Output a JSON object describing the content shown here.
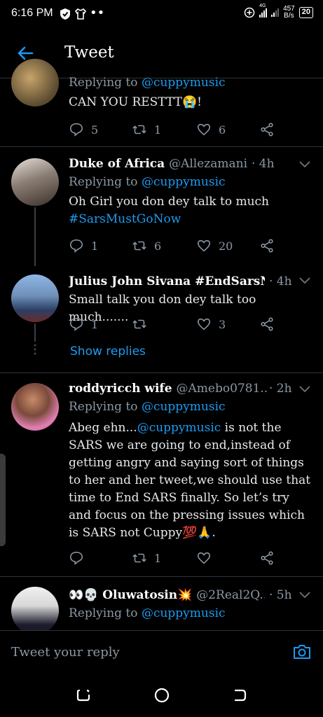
{
  "status_bar": {
    "time": "6:16 PM",
    "net_speed_value": "457",
    "net_speed_unit": "B/s",
    "battery": "20",
    "signal_label": "4G"
  },
  "header": {
    "title": "Tweet"
  },
  "tweets": [
    {
      "reply_prefix": "Replying to ",
      "reply_to": "@cuppymusic",
      "text": "CAN YOU RESTTT😭!",
      "replies": "5",
      "retweets": "1",
      "likes": "6"
    },
    {
      "name": "Duke of Africa",
      "handle": "@Allezamani",
      "time": "· 4h",
      "reply_prefix": "Replying to ",
      "reply_to": "@cuppymusic",
      "text_line1": "Oh Girl you don dey talk to much",
      "hashtag": "#SarsMustGoNow",
      "replies": "1",
      "retweets": "6",
      "likes": "20"
    },
    {
      "name": "Julius John Sivana #EndSarsN...",
      "time": "· 4h",
      "text": "Small talk you don dey talk too much.......",
      "replies": "1",
      "retweets": "",
      "likes": "3",
      "show_replies": "Show replies"
    },
    {
      "name": "roddyricch wife",
      "handle": "@Amebo0781...",
      "time": "· 2h",
      "reply_prefix": "Replying to ",
      "reply_to": "@cuppymusic",
      "text_prefix": "Abeg ehn...",
      "text_mention": "@cuppymusic",
      "text_rest": " is not the SARS we are going to end,instead of getting angry and saying sort of things to her and her tweet,we should use that time to End SARS finally. So let’s try and focus on the pressing issues which is SARS not Cuppy💯🙏.",
      "replies": "",
      "retweets": "1",
      "likes": ""
    },
    {
      "name": "👀💀 Oluwatosin💥",
      "handle": "@2Real2Q...",
      "time": "· 5h",
      "reply_prefix": "Replying to ",
      "reply_to": "@cuppymusic"
    }
  ],
  "composer": {
    "placeholder": "Tweet your reply"
  },
  "icons": {
    "back": "arrow-left-icon",
    "reply": "comment-icon",
    "retweet": "retweet-icon",
    "like": "heart-icon",
    "share": "share-icon",
    "camera": "camera-icon",
    "chevron": "chevron-down-icon"
  },
  "colors": {
    "accent": "#1d9bf0",
    "background": "#000000",
    "muted": "#8b98a5"
  }
}
